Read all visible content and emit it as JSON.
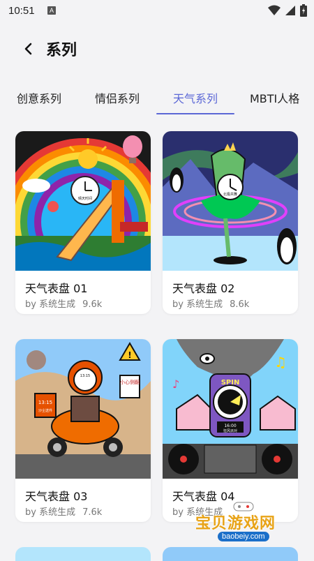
{
  "status": {
    "time": "10:51",
    "a_icon": "A"
  },
  "header": {
    "title": "系列"
  },
  "tabs": [
    {
      "label": "创意系列",
      "active": false
    },
    {
      "label": "情侣系列",
      "active": false
    },
    {
      "label": "天气系列",
      "active": true
    },
    {
      "label": "MBTI人格",
      "active": false
    }
  ],
  "cards": [
    {
      "name": "天气表盘 01",
      "author": "by 系统生成",
      "count": "9.6k",
      "theme": "rainbow-slide"
    },
    {
      "name": "天气表盘 02",
      "author": "by 系统生成",
      "count": "8.6k",
      "theme": "dancer-aurora"
    },
    {
      "name": "天气表盘 03",
      "author": "by 系统生成",
      "count": "7.6k",
      "theme": "scooter-sandstorm"
    },
    {
      "name": "天气表盘 04",
      "author": "by 系统生成",
      "count": "",
      "theme": "dj-tornado"
    }
  ],
  "thumb_text": {
    "clock1": "晴天时间",
    "clock2": "北极共舞",
    "clock3": "13:15",
    "clock3_sub": "沙尘送件",
    "sign3": "小心侧翻",
    "spin": "SPIN",
    "radio_time": "16:00",
    "radio_sub": "狂风派对"
  },
  "watermark": {
    "text": "宝贝游戏网",
    "url": "baobeiy.com"
  },
  "colors": {
    "accent": "#5b67d6",
    "background": "#f3f3f5"
  }
}
